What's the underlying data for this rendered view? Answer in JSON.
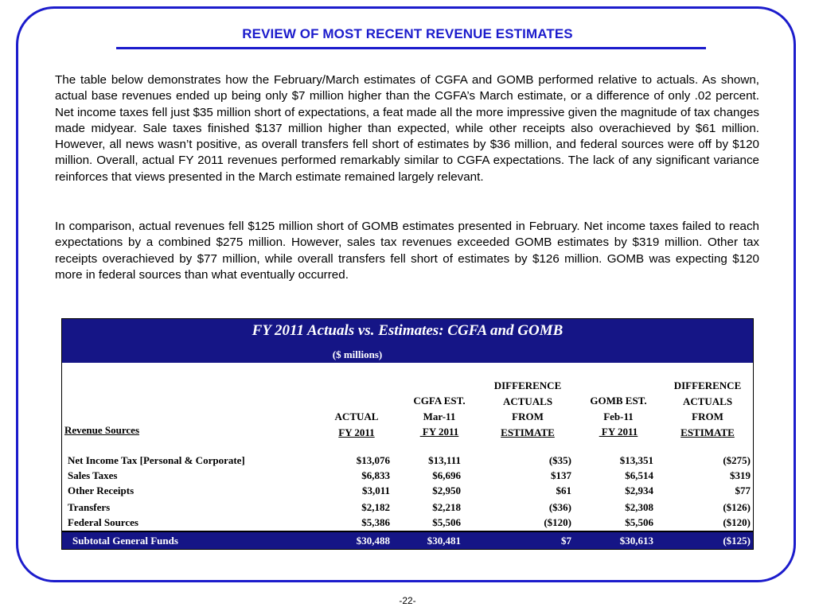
{
  "page": {
    "title": "REVIEW OF MOST RECENT REVENUE ESTIMATES",
    "paragraphs": [
      "The table below demonstrates how the February/March estimates of CGFA and GOMB performed relative to actuals. As shown, actual base revenues ended up being only $7 million higher than the CGFA’s March estimate, or a difference of only .02 percent.  Net income taxes fell just $35 million short of expectations, a feat made all the more impressive given the magnitude of tax changes made midyear.  Sale taxes finished $137 million higher than expected, while other receipts also overachieved by $61 million.  However, all news wasn’t positive, as overall transfers fell short of estimates by $36 million, and federal sources were off by $120 million.  Overall, actual FY 2011 revenues performed remarkably similar to CGFA expectations.  The lack of any significant variance reinforces that views presented in the March estimate remained largely relevant.",
      "In comparison, actual revenues fell $125 million short of GOMB estimates presented in February.  Net income taxes failed to reach expectations by a combined $275 million.  However, sales tax revenues exceeded GOMB estimates by $319 million.  Other tax receipts overachieved by $77 million, while overall transfers fell short of estimates by $126 million.  GOMB was expecting $120 more in federal sources than what eventually occurred."
    ],
    "page_number": "-22-"
  },
  "table": {
    "title": "FY 2011 Actuals vs. Estimates: CGFA and GOMB",
    "subtitle": "($ millions)",
    "row_header": "Revenue Sources",
    "columns": [
      {
        "lines": [
          "ACTUAL"
        ],
        "underlined": "FY 2011"
      },
      {
        "lines": [
          "CGFA EST.",
          "Mar-11"
        ],
        "underlined": " FY 2011"
      },
      {
        "lines": [
          "DIFFERENCE",
          "ACTUALS",
          "FROM"
        ],
        "underlined": "ESTIMATE"
      },
      {
        "lines": [
          "GOMB EST.",
          "Feb-11"
        ],
        "underlined": " FY 2011"
      },
      {
        "lines": [
          "DIFFERENCE",
          "ACTUALS",
          "FROM"
        ],
        "underlined": "ESTIMATE"
      }
    ],
    "rows": [
      {
        "name": "Net Income Tax [Personal & Corporate]",
        "values": [
          "$13,076",
          "$13,111",
          "($35)",
          "$13,351",
          "($275)"
        ]
      },
      {
        "name": "Sales Taxes",
        "values": [
          "$6,833",
          "$6,696",
          "$137",
          "$6,514",
          "$319"
        ]
      },
      {
        "name": "Other Receipts",
        "values": [
          "$3,011",
          "$2,950",
          "$61",
          "$2,934",
          "$77"
        ]
      },
      {
        "name": "Transfers",
        "values": [
          "$2,182",
          "$2,218",
          "($36)",
          "$2,308",
          "($126)"
        ]
      },
      {
        "name": "Federal Sources",
        "values": [
          "$5,386",
          "$5,506",
          "($120)",
          "$5,506",
          "($120)"
        ]
      }
    ],
    "subtotal": {
      "name": "Subtotal General Funds",
      "values": [
        "$30,488",
        "$30,481",
        "$7",
        "$30,613",
        "($125)"
      ]
    }
  }
}
